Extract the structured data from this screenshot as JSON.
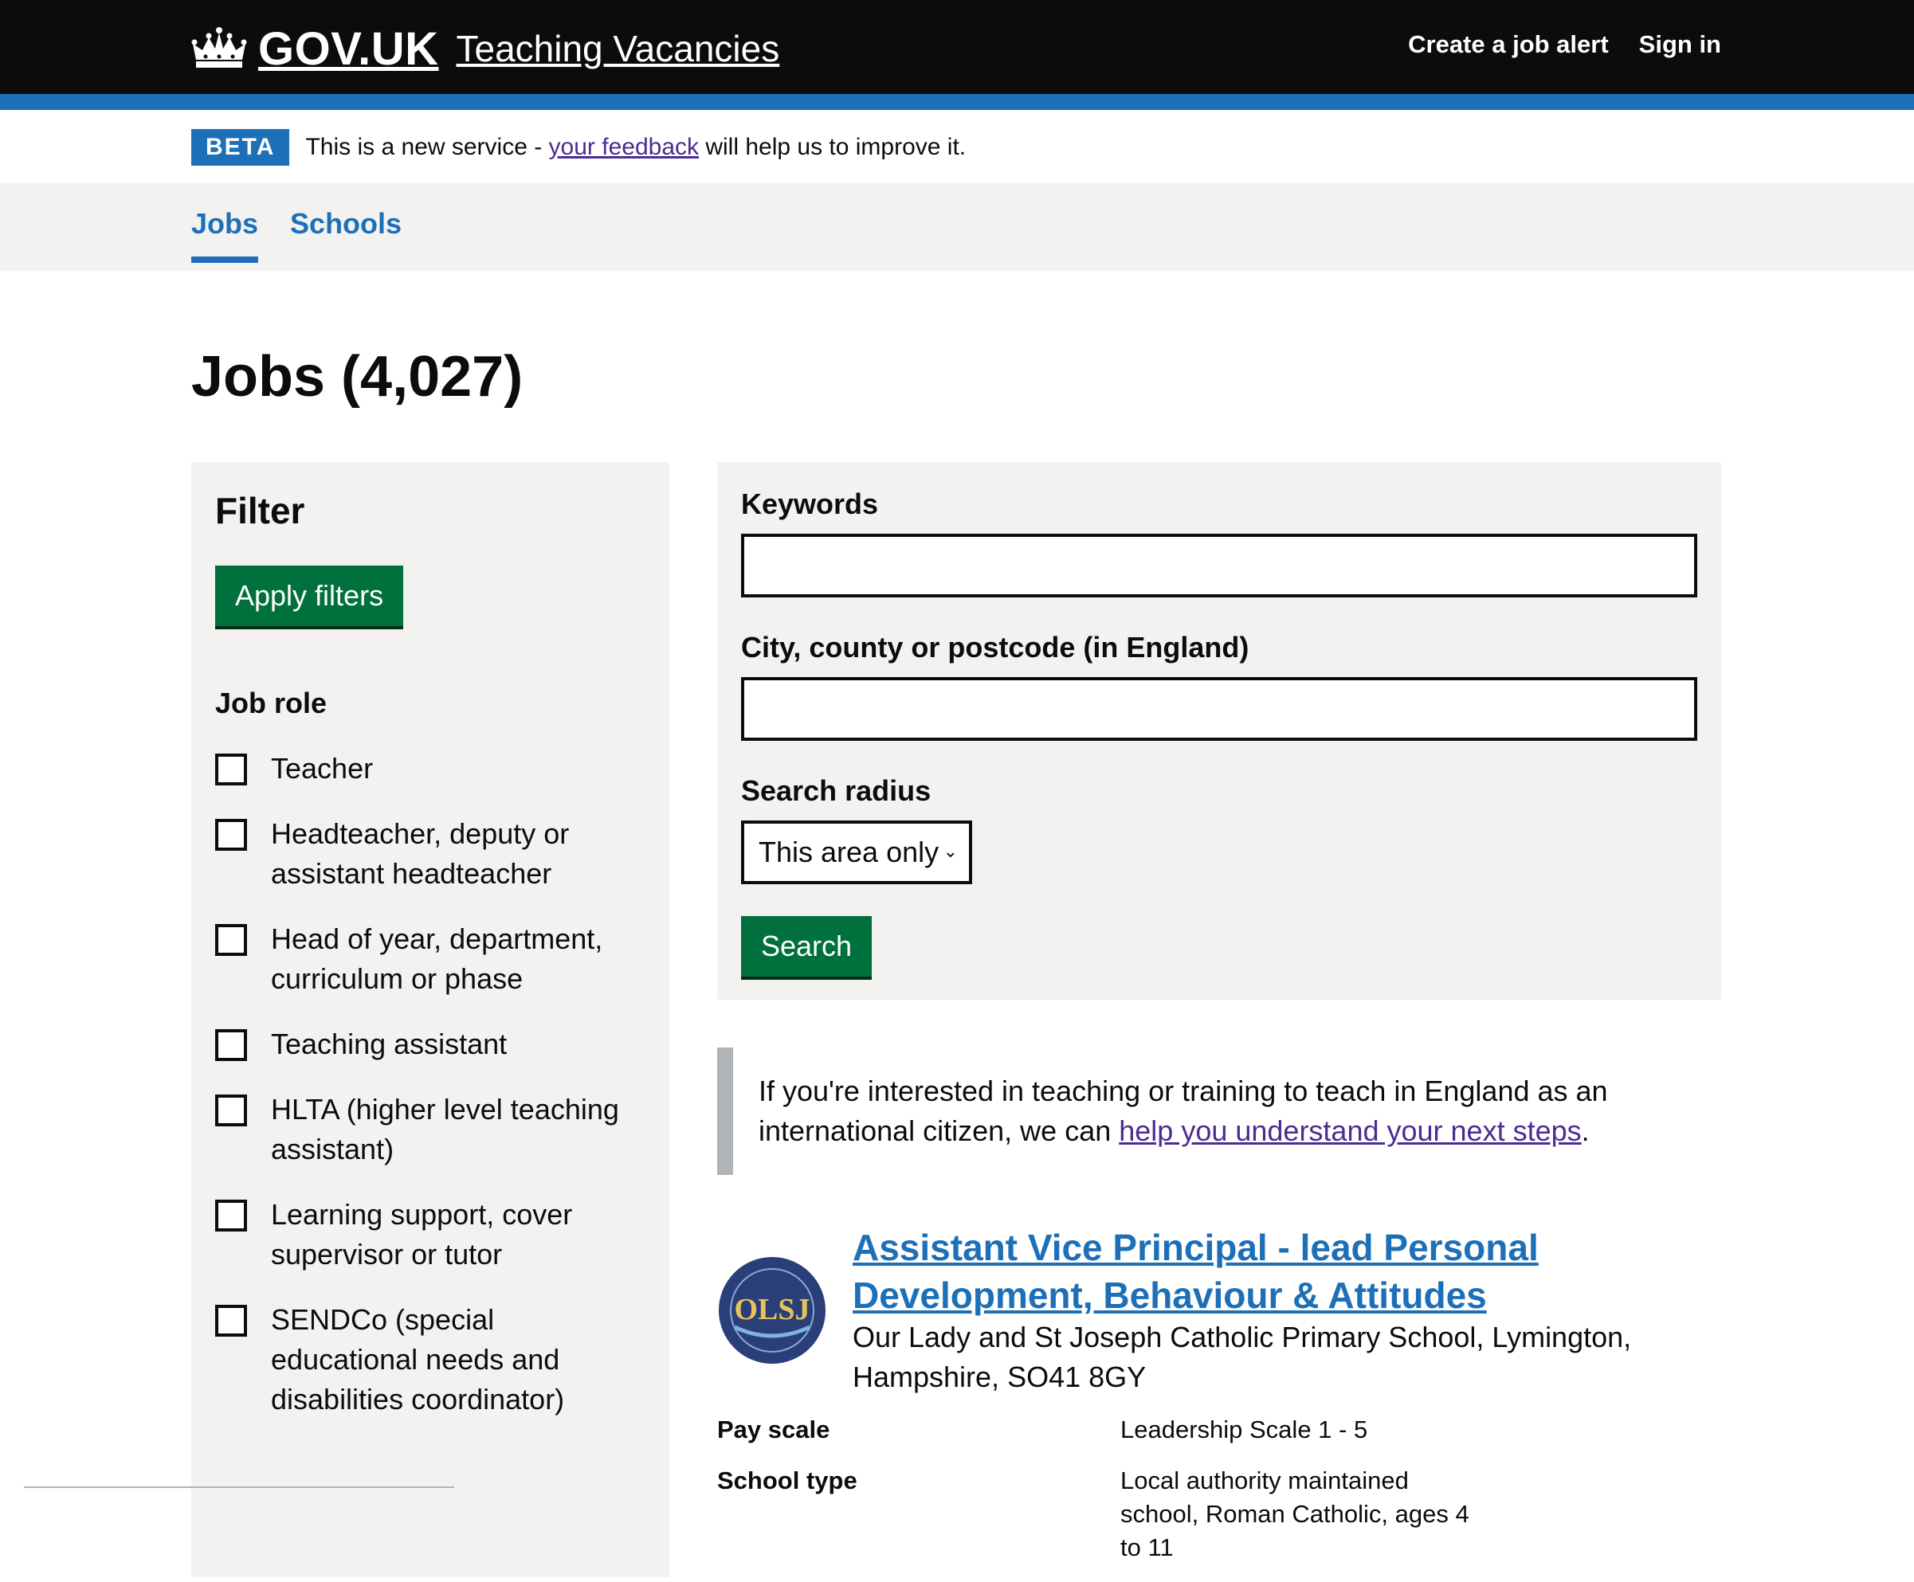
{
  "header": {
    "logo_text": "GOV.UK",
    "service_name": "Teaching Vacancies",
    "nav": [
      {
        "label": "Create a job alert"
      },
      {
        "label": "Sign in"
      }
    ]
  },
  "beta_banner": {
    "tag": "BETA",
    "text_before": "This is a new service - ",
    "link_text": "your feedback",
    "text_after": " will help us to improve it."
  },
  "subnav": {
    "items": [
      {
        "label": "Jobs",
        "active": true
      },
      {
        "label": "Schools",
        "active": false
      }
    ]
  },
  "page_title": "Jobs (4,027)",
  "filter": {
    "title": "Filter",
    "apply_label": "Apply filters",
    "job_role_legend": "Job role",
    "job_roles": [
      "Teacher",
      "Headteacher, deputy or assistant headteacher",
      "Head of year, department, curriculum or phase",
      "Teaching assistant",
      "HLTA (higher level teaching assistant)",
      "Learning support, cover supervisor or tutor",
      "SENDCo (special educational needs and disabilities coordinator)"
    ]
  },
  "search": {
    "keywords_label": "Keywords",
    "keywords_value": "",
    "location_label": "City, county or postcode (in England)",
    "location_value": "",
    "radius_label": "Search radius",
    "radius_selected": "This area only",
    "search_button": "Search"
  },
  "inset": {
    "text_before": "If you're interested in teaching or training to teach in England as an international citizen, we can ",
    "link_text": "help you understand your next steps",
    "text_after": "."
  },
  "job": {
    "logo_initials": "OLSJ",
    "title": "Assistant Vice Principal - lead Personal Development, Behaviour & Attitudes",
    "school": "Our Lady and St Joseph Catholic Primary School, Lymington, Hampshire, SO41 8GY",
    "pay_scale_label": "Pay scale",
    "pay_scale_value": "Leadership Scale 1 - 5",
    "school_type_label": "School type",
    "school_type_value": "Local authority maintained school, Roman Catholic, ages 4 to 11"
  },
  "colors": {
    "header_bg": "#0b0c0c",
    "brand_blue": "#1d70b8",
    "button_green": "#00703c",
    "panel_grey": "#f3f2f1",
    "visited_link": "#4c2c92"
  },
  "icons": [
    "crown-icon",
    "chevron-down-icon"
  ]
}
